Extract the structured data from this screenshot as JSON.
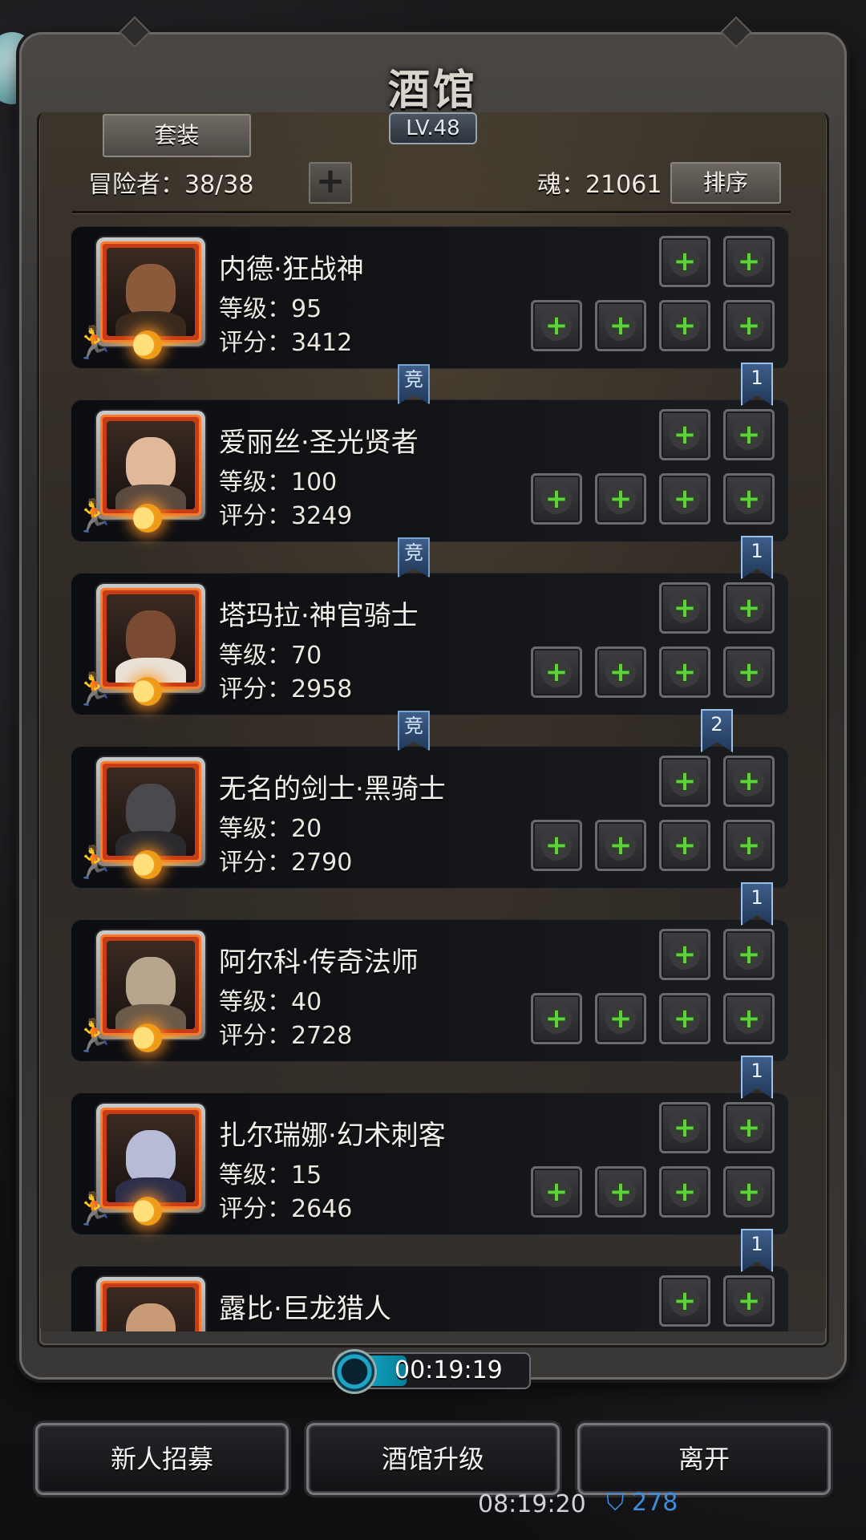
{
  "header": {
    "title": "酒馆",
    "level": "LV.48",
    "suit_label": "套装",
    "adventurers": "冒险者：38/38",
    "soul": "魂：21061",
    "sort_label": "排序"
  },
  "heroes": [
    {
      "name": "内德·狂战神",
      "level": "等级：95",
      "score": "评分：3412",
      "skin": "#8a5a3a",
      "cloth": "#3a2a1e"
    },
    {
      "name": "爱丽丝·圣光贤者",
      "level": "等级：100",
      "score": "评分：3249",
      "skin": "#e2b89a",
      "cloth": "#5a4a40"
    },
    {
      "name": "塔玛拉·神官骑士",
      "level": "等级：70",
      "score": "评分：2958",
      "skin": "#7a4a32",
      "cloth": "#e8e2d8"
    },
    {
      "name": "无名的剑士·黑骑士",
      "level": "等级：20",
      "score": "评分：2790",
      "skin": "#4a4a4e",
      "cloth": "#2a2a2e"
    },
    {
      "name": "阿尔科·传奇法师",
      "level": "等级：40",
      "score": "评分：2728",
      "skin": "#b8a58e",
      "cloth": "#6a5a48"
    },
    {
      "name": "扎尔瑞娜·幻术刺客",
      "level": "等级：15",
      "score": "评分：2646",
      "skin": "#b7bbd6",
      "cloth": "#2d2f4a"
    },
    {
      "name": "露比·巨龙猎人",
      "level": "",
      "score": "",
      "skin": "#c99a78",
      "cloth": "#6a4020"
    }
  ],
  "badges": {
    "compete": "竞",
    "numbers": [
      "1",
      "1",
      "2",
      "1",
      "1",
      "1"
    ]
  },
  "timer": {
    "value": "00:19:19",
    "progress": 0.35
  },
  "buttons": {
    "recruit": "新人招募",
    "upgrade": "酒馆升级",
    "leave": "离开"
  },
  "status": {
    "time": "08:19:20",
    "shield_value": "278"
  }
}
